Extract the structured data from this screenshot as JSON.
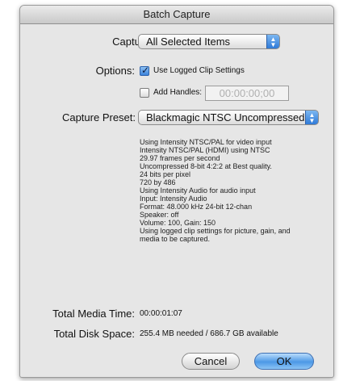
{
  "window": {
    "title": "Batch Capture"
  },
  "capture": {
    "label": "Capture:",
    "selected": "All Selected Items"
  },
  "options": {
    "label": "Options:",
    "use_logged_clip_settings": "Use Logged Clip Settings",
    "use_logged_clip_settings_checked": true,
    "add_handles": "Add Handles:",
    "add_handles_checked": false,
    "handles_value": "00:00:00;00"
  },
  "capture_preset": {
    "label": "Capture Preset:",
    "selected": "Blackmagic NTSC Uncompressed"
  },
  "description": {
    "lines": [
      "Using Intensity NTSC/PAL for video input",
      "Intensity NTSC/PAL (HDMI) using NTSC",
      "29.97 frames per second",
      "Uncompressed 8-bit 4:2:2 at Best quality.",
      "24 bits per pixel",
      "720 by 486",
      "Using Intensity Audio for audio input",
      "Input: Intensity Audio",
      "Format: 48.000 kHz 24-bit 12-chan",
      "Speaker: off",
      "Volume: 100, Gain: 150",
      "Using logged clip settings for picture, gain, and",
      "media to be captured."
    ]
  },
  "totals": {
    "media_time_label": "Total Media Time:",
    "media_time_value": "00:00:01:07",
    "disk_space_label": "Total Disk Space:",
    "disk_space_value": "255.4 MB needed / 686.7 GB available"
  },
  "buttons": {
    "cancel": "Cancel",
    "ok": "OK"
  },
  "icons": {
    "popup_arrows": "up-down-arrows-icon",
    "checkmark": "checkmark-icon"
  }
}
